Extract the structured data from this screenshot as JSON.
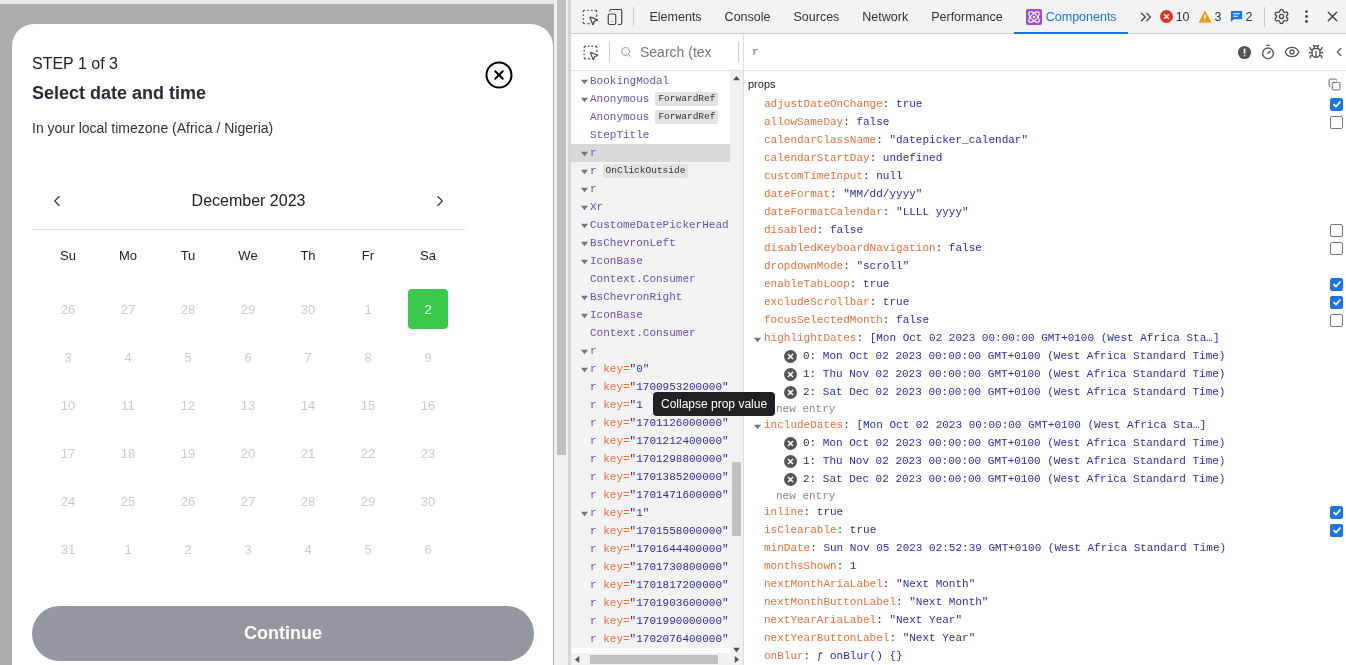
{
  "modal": {
    "step": "STEP 1 of 3",
    "title": "Select date and time",
    "subtitle": "In your local timezone (Africa / Nigeria)",
    "calendar": {
      "month": "December 2023",
      "weekdays": [
        "Su",
        "Mo",
        "Tu",
        "We",
        "Th",
        "Fr",
        "Sa"
      ],
      "weeks": [
        [
          {
            "day": "26",
            "selected": false,
            "disabled": true
          },
          {
            "day": "27",
            "selected": false,
            "disabled": true
          },
          {
            "day": "28",
            "selected": false,
            "disabled": true
          },
          {
            "day": "29",
            "selected": false,
            "disabled": true
          },
          {
            "day": "30",
            "selected": false,
            "disabled": true
          },
          {
            "day": "1",
            "selected": false,
            "disabled": true
          },
          {
            "day": "2",
            "selected": true,
            "disabled": false
          }
        ],
        [
          {
            "day": "3",
            "selected": false,
            "disabled": true
          },
          {
            "day": "4",
            "selected": false,
            "disabled": true
          },
          {
            "day": "5",
            "selected": false,
            "disabled": true
          },
          {
            "day": "6",
            "selected": false,
            "disabled": true
          },
          {
            "day": "7",
            "selected": false,
            "disabled": true
          },
          {
            "day": "8",
            "selected": false,
            "disabled": true
          },
          {
            "day": "9",
            "selected": false,
            "disabled": true
          }
        ],
        [
          {
            "day": "10",
            "selected": false,
            "disabled": true
          },
          {
            "day": "11",
            "selected": false,
            "disabled": true
          },
          {
            "day": "12",
            "selected": false,
            "disabled": true
          },
          {
            "day": "13",
            "selected": false,
            "disabled": true
          },
          {
            "day": "14",
            "selected": false,
            "disabled": true
          },
          {
            "day": "15",
            "selected": false,
            "disabled": true
          },
          {
            "day": "16",
            "selected": false,
            "disabled": true
          }
        ],
        [
          {
            "day": "17",
            "selected": false,
            "disabled": true
          },
          {
            "day": "18",
            "selected": false,
            "disabled": true
          },
          {
            "day": "19",
            "selected": false,
            "disabled": true
          },
          {
            "day": "20",
            "selected": false,
            "disabled": true
          },
          {
            "day": "21",
            "selected": false,
            "disabled": true
          },
          {
            "day": "22",
            "selected": false,
            "disabled": true
          },
          {
            "day": "23",
            "selected": false,
            "disabled": true
          }
        ],
        [
          {
            "day": "24",
            "selected": false,
            "disabled": true
          },
          {
            "day": "25",
            "selected": false,
            "disabled": true
          },
          {
            "day": "26",
            "selected": false,
            "disabled": true
          },
          {
            "day": "27",
            "selected": false,
            "disabled": true
          },
          {
            "day": "28",
            "selected": false,
            "disabled": true
          },
          {
            "day": "29",
            "selected": false,
            "disabled": true
          },
          {
            "day": "30",
            "selected": false,
            "disabled": true
          }
        ],
        [
          {
            "day": "31",
            "selected": false,
            "disabled": true
          },
          {
            "day": "1",
            "selected": false,
            "disabled": true
          },
          {
            "day": "2",
            "selected": false,
            "disabled": true
          },
          {
            "day": "3",
            "selected": false,
            "disabled": true
          },
          {
            "day": "4",
            "selected": false,
            "disabled": true
          },
          {
            "day": "5",
            "selected": false,
            "disabled": true
          },
          {
            "day": "6",
            "selected": false,
            "disabled": true
          }
        ]
      ]
    },
    "continue_button": {
      "label": "Continue",
      "disabled": true
    }
  },
  "devtools": {
    "tabs": [
      {
        "label": "Elements",
        "selected": false
      },
      {
        "label": "Console",
        "selected": false
      },
      {
        "label": "Sources",
        "selected": false
      },
      {
        "label": "Network",
        "selected": false
      },
      {
        "label": "Performance",
        "selected": false
      },
      {
        "label": "Components",
        "selected": true
      }
    ],
    "errors": "10",
    "warnings": "3",
    "messages": "2",
    "search": {
      "placeholder": "Search (tex"
    },
    "selected_component": "r",
    "tree": [
      {
        "kind": "branch",
        "name": "BookingModal",
        "selected": false
      },
      {
        "kind": "branch",
        "name": "Anonymous",
        "badge": "ForwardRef",
        "selected": false
      },
      {
        "kind": "leaf",
        "name": "Anonymous",
        "badge": "ForwardRef",
        "selected": false
      },
      {
        "kind": "leaf",
        "name": "StepTitle",
        "selected": false
      },
      {
        "kind": "branch",
        "name": "r",
        "selected": true
      },
      {
        "kind": "branch",
        "name": "r",
        "badge": "OnClickOutside",
        "selected": false
      },
      {
        "kind": "branch",
        "name": "r",
        "selected": false
      },
      {
        "kind": "branch",
        "name": "Xr",
        "selected": false
      },
      {
        "kind": "branch",
        "name": "CustomeDatePickerHead",
        "selected": false
      },
      {
        "kind": "branch",
        "name": "BsChevronLeft",
        "selected": false
      },
      {
        "kind": "branch",
        "name": "IconBase",
        "selected": false
      },
      {
        "kind": "leaf",
        "name": "Context.Consumer",
        "selected": false
      },
      {
        "kind": "branch",
        "name": "BsChevronRight",
        "selected": false
      },
      {
        "kind": "branch",
        "name": "IconBase",
        "selected": false
      },
      {
        "kind": "leaf",
        "name": "Context.Consumer",
        "selected": false
      },
      {
        "kind": "branch",
        "name": "r",
        "selected": false
      },
      {
        "kind": "branch",
        "name": "r",
        "key_label": "key=",
        "key": "\"0\"",
        "selected": false
      },
      {
        "kind": "leaf",
        "name": "r",
        "key_label": "key=",
        "key": "\"1700953200000\"",
        "selected": false
      },
      {
        "kind": "leaf",
        "name": "r",
        "key_label": "key=",
        "key": "\"1",
        "selected": false
      },
      {
        "kind": "leaf",
        "name": "r",
        "key_label": "key=",
        "key": "\"1701126000000\"",
        "selected": false
      },
      {
        "kind": "leaf",
        "name": "r",
        "key_label": "key=",
        "key": "\"1701212400000\"",
        "selected": false
      },
      {
        "kind": "leaf",
        "name": "r",
        "key_label": "key=",
        "key": "\"1701298800000\"",
        "selected": false
      },
      {
        "kind": "leaf",
        "name": "r",
        "key_label": "key=",
        "key": "\"1701385200000\"",
        "selected": false
      },
      {
        "kind": "leaf",
        "name": "r",
        "key_label": "key=",
        "key": "\"1701471600000\"",
        "selected": false
      },
      {
        "kind": "branch",
        "name": "r",
        "key_label": "key=",
        "key": "\"1\"",
        "selected": false
      },
      {
        "kind": "leaf",
        "name": "r",
        "key_label": "key=",
        "key": "\"1701558000000\"",
        "selected": false
      },
      {
        "kind": "leaf",
        "name": "r",
        "key_label": "key=",
        "key": "\"1701644400000\"",
        "selected": false
      },
      {
        "kind": "leaf",
        "name": "r",
        "key_label": "key=",
        "key": "\"1701730800000\"",
        "selected": false
      },
      {
        "kind": "leaf",
        "name": "r",
        "key_label": "key=",
        "key": "\"1701817200000\"",
        "selected": false
      },
      {
        "kind": "leaf",
        "name": "r",
        "key_label": "key=",
        "key": "\"1701903600000\"",
        "selected": false
      },
      {
        "kind": "leaf",
        "name": "r",
        "key_label": "key=",
        "key": "\"1701990000000\"",
        "selected": false
      },
      {
        "kind": "leaf",
        "name": "r",
        "key_label": "key=",
        "key": "\"1702076400000\"",
        "selected": false
      }
    ],
    "props": {
      "title": "props",
      "separator": ":",
      "items": [
        {
          "kind": "boolean",
          "name": "adjustDateOnChange",
          "value": "true",
          "checked": true
        },
        {
          "kind": "boolean",
          "name": "allowSameDay",
          "value": "false",
          "checked": false
        },
        {
          "kind": "value",
          "name": "calendarClassName",
          "value": "\"datepicker_calendar\""
        },
        {
          "kind": "value",
          "name": "calendarStartDay",
          "value": "undefined"
        },
        {
          "kind": "value",
          "name": "customTimeInput",
          "value": "null"
        },
        {
          "kind": "value",
          "name": "dateFormat",
          "value": "\"MM/dd/yyyy\""
        },
        {
          "kind": "value",
          "name": "dateFormatCalendar",
          "value": "\"LLLL yyyy\""
        },
        {
          "kind": "boolean",
          "name": "disabled",
          "value": "false",
          "checked": false
        },
        {
          "kind": "boolean",
          "name": "disabledKeyboardNavigation",
          "value": "false",
          "checked": false
        },
        {
          "kind": "value",
          "name": "dropdownMode",
          "value": "\"scroll\""
        },
        {
          "kind": "boolean",
          "name": "enableTabLoop",
          "value": "true",
          "checked": true
        },
        {
          "kind": "boolean",
          "name": "excludeScrollbar",
          "value": "true",
          "checked": true
        },
        {
          "kind": "boolean",
          "name": "focusSelectedMonth",
          "value": "false",
          "checked": false
        },
        {
          "kind": "array",
          "name": "highlightDates",
          "value": "[Mon Oct 02 2023 00:00:00 GMT+0100 (West Africa Sta…]",
          "expanded": true,
          "new_entry": "new entry",
          "entries": [
            {
              "index": "0:",
              "value": "Mon Oct 02 2023 00:00:00 GMT+0100 (West Africa Standard Time)"
            },
            {
              "index": "1:",
              "value": "Thu Nov 02 2023 00:00:00 GMT+0100 (West Africa Standard Time)"
            },
            {
              "index": "2:",
              "value": "Sat Dec 02 2023 00:00:00 GMT+0100 (West Africa Standard Time)"
            }
          ]
        },
        {
          "kind": "array",
          "name": "includeDates",
          "value": "[Mon Oct 02 2023 00:00:00 GMT+0100 (West Africa Sta…]",
          "expanded": true,
          "new_entry": "new entry",
          "entries": [
            {
              "index": "0:",
              "value": "Mon Oct 02 2023 00:00:00 GMT+0100 (West Africa Standard Time)"
            },
            {
              "index": "1:",
              "value": "Thu Nov 02 2023 00:00:00 GMT+0100 (West Africa Standard Time)"
            },
            {
              "index": "2:",
              "value": "Sat Dec 02 2023 00:00:00 GMT+0100 (West Africa Standard Time)"
            }
          ]
        },
        {
          "kind": "boolean",
          "name": "inline",
          "value": "true",
          "checked": true
        },
        {
          "kind": "boolean",
          "name": "isClearable",
          "value": "true",
          "checked": true
        },
        {
          "kind": "value",
          "name": "minDate",
          "value": "Sun Nov 05 2023 02:52:39 GMT+0100 (West Africa Standard Time)"
        },
        {
          "kind": "value",
          "name": "monthsShown",
          "value": "1"
        },
        {
          "kind": "value",
          "name": "nextMonthAriaLabel",
          "value": "\"Next Month\""
        },
        {
          "kind": "value",
          "name": "nextMonthButtonLabel",
          "value": "\"Next Month\""
        },
        {
          "kind": "value",
          "name": "nextYearAriaLabel",
          "value": "\"Next Year\""
        },
        {
          "kind": "value",
          "name": "nextYearButtonLabel",
          "value": "\"Next Year\""
        },
        {
          "kind": "value",
          "name": "onBlur",
          "value": "ƒ onBlur() {}"
        }
      ]
    },
    "tooltip": "Collapse prop value"
  }
}
